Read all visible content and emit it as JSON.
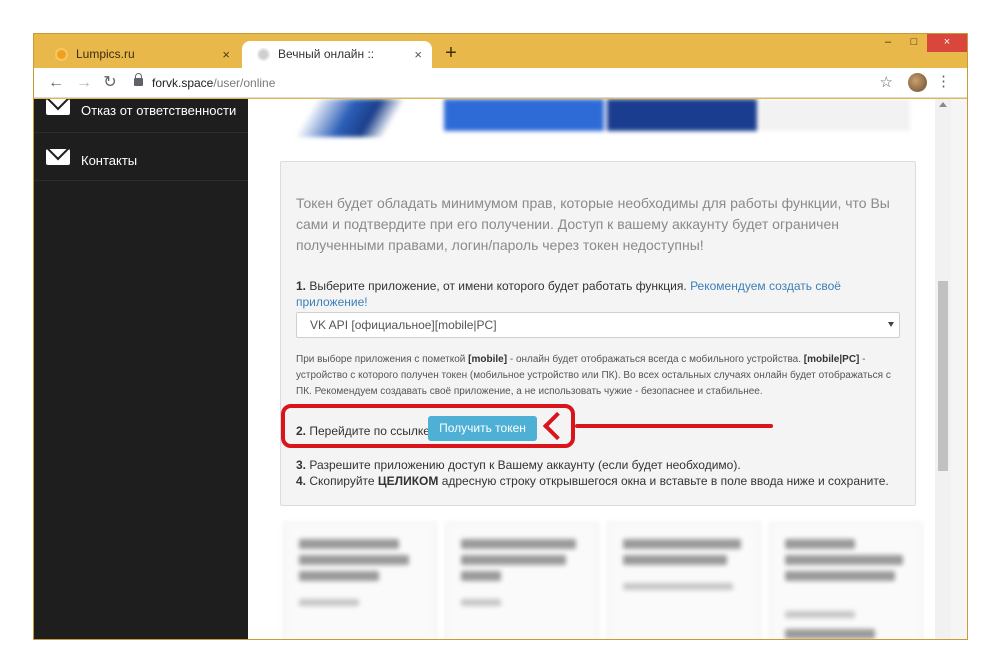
{
  "browser": {
    "tabs": [
      {
        "title": "Lumpics.ru",
        "active": false
      },
      {
        "title": "Вечный онлайн :: FORVK.SPACE",
        "active": true
      }
    ],
    "new_tab_label": "+",
    "close_glyph": "×",
    "window_controls": {
      "minimize": "–",
      "maximize": "□",
      "close": "×"
    },
    "url_host": "forvk.space",
    "url_path": "/user/online"
  },
  "sidebar": {
    "items": [
      {
        "label": "Отказ от ответственности",
        "icon": "envelope-icon"
      },
      {
        "label": "Контакты",
        "icon": "envelope-icon"
      }
    ],
    "background": "#1e1e1e"
  },
  "panel": {
    "intro": "Токен будет обладать минимумом прав, которые необходимы для работы функции, что Вы сами и подтвердите при его получении. Доступ к вашему аккаунту будет ограничен полученными правами, логин/пароль через токен недоступны!",
    "step1_num": "1.",
    "step1_text": " Выберите приложение, от имени которого будет работать функция. ",
    "step1_link": "Рекомендуем создать своё приложение!",
    "select_value": "VK API [официальное][mobile|PC]",
    "note_part1": "При выборе приложения с пометкой ",
    "note_mobile": "[mobile]",
    "note_part2": " - онлайн будет отображаться всегда с мобильного устройства. ",
    "note_mobile_pc": "[mobile|PC]",
    "note_part3": " - устройство с которого получен токен (мобильное устройство или ПК). Во всех остальных случаях онлайн будет отображаться с ПК. Рекомендуем создавать своё приложение, а не использовать чужие - безопаснее и стабильнее.",
    "step2_num": "2.",
    "step2_text": " Перейдите по ссылке",
    "token_button": "Получить токен",
    "step3_num": "3.",
    "step3_text": " Разрешите приложению доступ к Вашему аккаунту (если будет необходимо).",
    "step4_num": "4.",
    "step4_text_a": " Скопируйте ",
    "step4_bold": "ЦЕЛИКОМ",
    "step4_text_b": " адресную строку открывшегося окна и вставьте в поле ввода ниже и сохраните."
  },
  "colors": {
    "title_bar": "#e9b84a",
    "button": "#4fb0d6",
    "link": "#3d7fb8",
    "annotation": "#d9141b"
  }
}
